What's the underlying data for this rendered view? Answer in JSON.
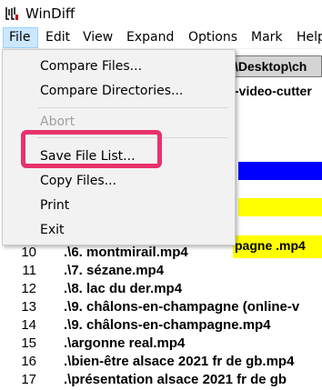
{
  "window": {
    "title": "WinDiff"
  },
  "menubar": {
    "items": [
      {
        "label": "File"
      },
      {
        "label": "Edit"
      },
      {
        "label": "View"
      },
      {
        "label": "Expand"
      },
      {
        "label": "Options"
      },
      {
        "label": "Mark"
      },
      {
        "label": "Help"
      }
    ]
  },
  "file_menu": {
    "items": [
      {
        "label": "Compare Files...",
        "enabled": true
      },
      {
        "label": "Compare Directories...",
        "enabled": true
      },
      {
        "label": "Abort",
        "enabled": false
      },
      {
        "label": "Save File List...",
        "enabled": true,
        "highlighted": true
      },
      {
        "label": "Copy Files...",
        "enabled": true
      },
      {
        "label": "Print",
        "enabled": true
      },
      {
        "label": "Exit",
        "enabled": true
      }
    ],
    "highlight_color": "#e8326c"
  },
  "background": {
    "path_header": "\\Desktop\\ch",
    "line1": "-video-cutter",
    "line_yellow": "pagne .mp4",
    "colors": {
      "blue": "#0000ff",
      "yellow": "#ffff00"
    }
  },
  "file_list": [
    {
      "num": "10",
      "name": ".\\6. montmirail.mp4"
    },
    {
      "num": "11",
      "name": ".\\7. sézane.mp4"
    },
    {
      "num": "12",
      "name": ".\\8. lac du der.mp4"
    },
    {
      "num": "13",
      "name": ".\\9. châlons-en-champagne (online-v"
    },
    {
      "num": "14",
      "name": ".\\9. châlons-en-champagne.mp4"
    },
    {
      "num": "15",
      "name": ".\\argonne real.mp4"
    },
    {
      "num": "16",
      "name": ".\\bien-être alsace 2021 fr de gb.mp4"
    },
    {
      "num": "17",
      "name": ".\\présentation alsace 2021 fr de gb"
    }
  ]
}
